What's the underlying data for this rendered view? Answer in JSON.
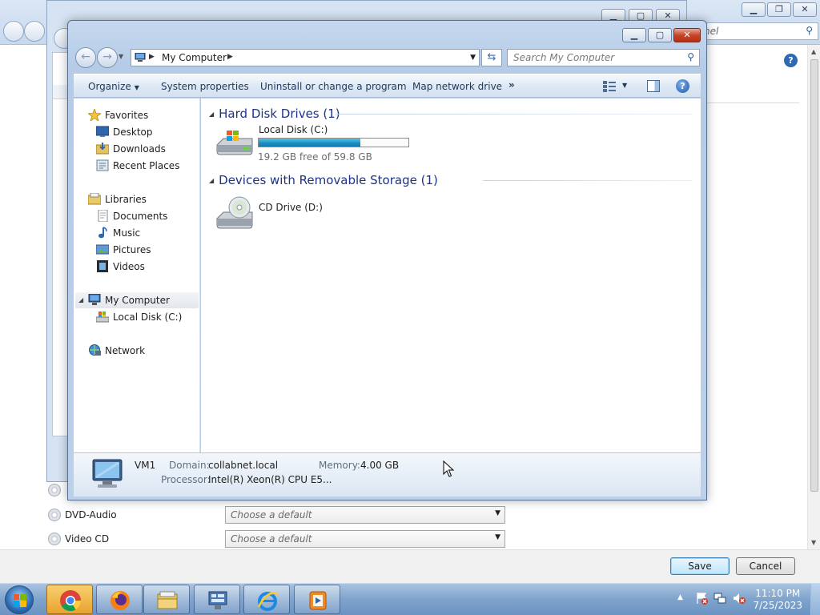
{
  "background": {
    "search_placeholder": "nel",
    "autoplay_rows": [
      {
        "label": "DVD-Audio",
        "value": "Choose a default"
      },
      {
        "label": "Video CD",
        "value": "Choose a default"
      }
    ],
    "save_label": "Save",
    "cancel_label": "Cancel"
  },
  "explorer": {
    "address": "My Computer",
    "search_placeholder": "Search My Computer",
    "commands": [
      "Organize",
      "System properties",
      "Uninstall or change a program",
      "Map network drive"
    ],
    "more": "»",
    "nav": {
      "favorites": "Favorites",
      "desktop": "Desktop",
      "downloads": "Downloads",
      "recent": "Recent Places",
      "libraries": "Libraries",
      "documents": "Documents",
      "music": "Music",
      "pictures": "Pictures",
      "videos": "Videos",
      "computer": "My Computer",
      "local_disk": "Local Disk (C:)",
      "network": "Network"
    },
    "groups": {
      "hdd": "Hard Disk Drives (1)",
      "removable": "Devices with Removable Storage (1)"
    },
    "drives": {
      "c_name": "Local Disk (C:)",
      "c_free": "19.2 GB free of 59.8 GB",
      "c_used_fraction": 0.679,
      "d_name": "CD Drive (D:)"
    },
    "details": {
      "name": "VM1",
      "domain_label": "Domain:",
      "domain": "collabnet.local",
      "memory_label": "Memory:",
      "memory": "4.00 GB",
      "processor_label": "Processor:",
      "processor": "Intel(R) Xeon(R) CPU E5..."
    }
  },
  "taskbar": {
    "apps": [
      "chrome-icon",
      "firefox-icon",
      "explorer-icon",
      "control-panel-icon",
      "ie-icon",
      "media-player-icon"
    ],
    "time": "11:10 PM",
    "date": "7/25/2023"
  },
  "colors": {
    "accent": "#1e3287",
    "progress": "#1b90c4",
    "taskbar": "#7fa3cc"
  }
}
